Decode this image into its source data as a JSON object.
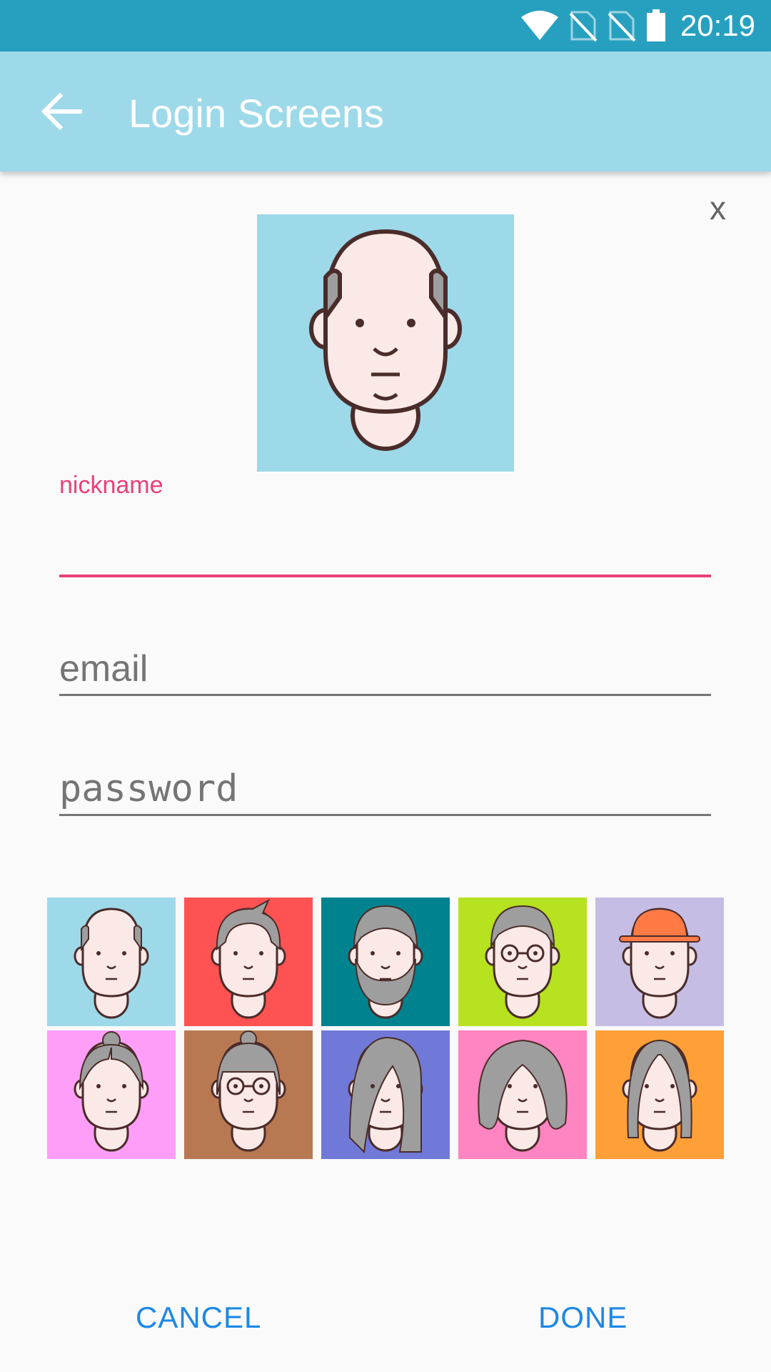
{
  "status_bar": {
    "time": "20:19",
    "icons": [
      "wifi-icon",
      "no-sim-icon",
      "no-sim-icon",
      "battery-icon"
    ]
  },
  "toolbar": {
    "title": "Login Screens",
    "back_icon": "arrow-back-icon"
  },
  "dialog": {
    "close_label": "x",
    "selected_avatar": {
      "bg": "#9dd9e9",
      "style": "bald-old-man"
    },
    "fields": {
      "nickname": {
        "label": "nickname",
        "value": "",
        "placeholder": ""
      },
      "email": {
        "placeholder": "email",
        "value": ""
      },
      "password": {
        "placeholder": "password",
        "value": ""
      }
    },
    "avatars": [
      {
        "bg": "#9dd9e9",
        "style": "bald-old-man"
      },
      {
        "bg": "#ff5252",
        "style": "spiky-gray-hair"
      },
      {
        "bg": "#00838f",
        "style": "bearded-man"
      },
      {
        "bg": "#b6e21f",
        "style": "glasses-man"
      },
      {
        "bg": "#c5bde3",
        "style": "hat-man"
      },
      {
        "bg": "#ff9ef9",
        "style": "bun-woman"
      },
      {
        "bg": "#b87852",
        "style": "bangs-glasses-woman"
      },
      {
        "bg": "#7179d8",
        "style": "long-hair-woman"
      },
      {
        "bg": "#ff84c2",
        "style": "curly-hair-woman"
      },
      {
        "bg": "#ff9f38",
        "style": "parted-hair-woman"
      }
    ],
    "buttons": {
      "cancel": "CANCEL",
      "done": "DONE"
    }
  },
  "colors": {
    "status_bar": "#27a0bf",
    "toolbar": "#9dd9e9",
    "accent": "#ec407a",
    "button_text": "#1e88e5"
  }
}
